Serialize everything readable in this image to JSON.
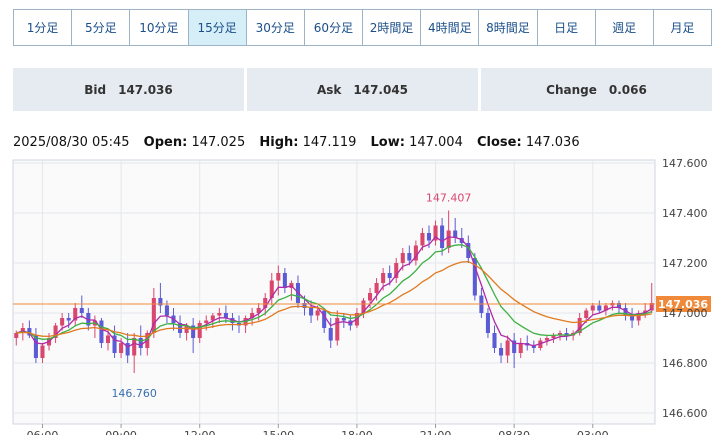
{
  "tabs": [
    {
      "label": "1分足",
      "active": false
    },
    {
      "label": "5分足",
      "active": false
    },
    {
      "label": "10分足",
      "active": false
    },
    {
      "label": "15分足",
      "active": true
    },
    {
      "label": "30分足",
      "active": false
    },
    {
      "label": "60分足",
      "active": false
    },
    {
      "label": "2時間足",
      "active": false
    },
    {
      "label": "4時間足",
      "active": false
    },
    {
      "label": "8時間足",
      "active": false
    },
    {
      "label": "日足",
      "active": false
    },
    {
      "label": "週足",
      "active": false
    },
    {
      "label": "月足",
      "active": false
    }
  ],
  "quotes": {
    "bid_label": "Bid",
    "bid_value": "147.036",
    "ask_label": "Ask",
    "ask_value": "147.045",
    "change_label": "Change",
    "change_value": "0.066"
  },
  "ohlc": {
    "datetime": "2025/08/30 05:45",
    "open_label": "Open:",
    "open": "147.025",
    "high_label": "High:",
    "high": "147.119",
    "low_label": "Low:",
    "low": "147.004",
    "close_label": "Close:",
    "close": "147.036"
  },
  "chart_data": {
    "type": "candlestick",
    "ylim": [
      146.6,
      147.6
    ],
    "y_ticks": [
      "147.600",
      "147.400",
      "147.200",
      "147.000",
      "146.800",
      "146.600"
    ],
    "x_tick_labels": [
      "06:00",
      "09:00",
      "12:00",
      "15:00",
      "18:00",
      "21:00",
      "08/30",
      "03:00"
    ],
    "x_tick_index": [
      4,
      16,
      28,
      40,
      52,
      64,
      76,
      88
    ],
    "grid": true,
    "current_price_label": "147.036",
    "current_price": 147.036,
    "annotations": [
      {
        "text": "147.407",
        "index": 66,
        "value": 147.407,
        "color": "#d9466e"
      },
      {
        "text": "146.760",
        "index": 18,
        "value": 146.76,
        "color": "#3a6fb0"
      }
    ],
    "colors": {
      "up": "#d9466e",
      "down": "#5b5bd6",
      "price_line": "#f08a3a",
      "ma_fast": "#b02aa8",
      "ma_mid": "#3cb043",
      "ma_slow": "#e07a1f"
    },
    "candles": [
      [
        146.9,
        146.93,
        146.87,
        146.92
      ],
      [
        146.92,
        146.96,
        146.89,
        146.94
      ],
      [
        146.94,
        146.97,
        146.9,
        146.91
      ],
      [
        146.91,
        146.94,
        146.8,
        146.82
      ],
      [
        146.82,
        146.88,
        146.8,
        146.87
      ],
      [
        146.87,
        146.92,
        146.85,
        146.9
      ],
      [
        146.9,
        146.96,
        146.88,
        146.95
      ],
      [
        146.95,
        147.0,
        146.93,
        146.98
      ],
      [
        146.98,
        147.0,
        146.94,
        146.97
      ],
      [
        146.97,
        147.04,
        146.95,
        147.02
      ],
      [
        147.02,
        147.07,
        146.98,
        147.0
      ],
      [
        147.0,
        147.02,
        146.93,
        146.95
      ],
      [
        146.95,
        146.99,
        146.9,
        146.97
      ],
      [
        146.97,
        146.98,
        146.86,
        146.88
      ],
      [
        146.88,
        146.93,
        146.85,
        146.91
      ],
      [
        146.91,
        146.95,
        146.82,
        146.84
      ],
      [
        146.84,
        146.9,
        146.82,
        146.88
      ],
      [
        146.88,
        146.92,
        146.8,
        146.83
      ],
      [
        146.83,
        146.92,
        146.76,
        146.9
      ],
      [
        146.9,
        146.95,
        146.83,
        146.86
      ],
      [
        146.86,
        146.93,
        146.83,
        146.92
      ],
      [
        146.92,
        147.1,
        146.9,
        147.06
      ],
      [
        147.06,
        147.12,
        147.0,
        147.03
      ],
      [
        147.03,
        147.05,
        146.96,
        146.99
      ],
      [
        146.99,
        147.02,
        146.93,
        146.96
      ],
      [
        146.96,
        146.99,
        146.9,
        146.92
      ],
      [
        146.92,
        146.96,
        146.89,
        146.95
      ],
      [
        146.95,
        146.98,
        146.84,
        146.9
      ],
      [
        146.9,
        146.97,
        146.88,
        146.96
      ],
      [
        146.96,
        146.99,
        146.93,
        146.97
      ],
      [
        146.97,
        147.0,
        146.94,
        146.99
      ],
      [
        146.99,
        147.02,
        146.96,
        147.0
      ],
      [
        147.0,
        147.03,
        146.96,
        146.98
      ],
      [
        146.98,
        147.0,
        146.93,
        146.96
      ],
      [
        146.96,
        146.99,
        146.92,
        146.95
      ],
      [
        146.95,
        146.99,
        146.92,
        146.98
      ],
      [
        146.98,
        147.02,
        146.95,
        147.0
      ],
      [
        147.0,
        147.04,
        146.97,
        147.02
      ],
      [
        147.02,
        147.08,
        146.99,
        147.06
      ],
      [
        147.06,
        147.16,
        147.03,
        147.13
      ],
      [
        147.13,
        147.19,
        147.07,
        147.16
      ],
      [
        147.16,
        147.18,
        147.08,
        147.1
      ],
      [
        147.1,
        147.13,
        147.05,
        147.12
      ],
      [
        147.12,
        147.15,
        147.02,
        147.04
      ],
      [
        147.04,
        147.07,
        146.99,
        147.02
      ],
      [
        147.02,
        147.05,
        146.96,
        146.99
      ],
      [
        146.99,
        147.03,
        146.97,
        147.01
      ],
      [
        147.01,
        147.02,
        146.92,
        146.94
      ],
      [
        146.94,
        146.98,
        146.86,
        146.89
      ],
      [
        146.89,
        147.01,
        146.87,
        146.98
      ],
      [
        146.98,
        147.0,
        146.94,
        146.97
      ],
      [
        146.97,
        146.99,
        146.93,
        146.95
      ],
      [
        146.95,
        147.02,
        146.94,
        147.0
      ],
      [
        147.0,
        147.06,
        146.98,
        147.05
      ],
      [
        147.05,
        147.1,
        147.02,
        147.08
      ],
      [
        147.08,
        147.14,
        147.05,
        147.12
      ],
      [
        147.12,
        147.18,
        147.09,
        147.16
      ],
      [
        147.16,
        147.19,
        147.11,
        147.14
      ],
      [
        147.14,
        147.22,
        147.12,
        147.2
      ],
      [
        147.2,
        147.26,
        147.17,
        147.24
      ],
      [
        147.24,
        147.27,
        147.19,
        147.21
      ],
      [
        147.21,
        147.29,
        147.19,
        147.27
      ],
      [
        147.27,
        147.34,
        147.25,
        147.32
      ],
      [
        147.32,
        147.35,
        147.26,
        147.29
      ],
      [
        147.29,
        147.37,
        147.27,
        147.35
      ],
      [
        147.35,
        147.38,
        147.23,
        147.26
      ],
      [
        147.26,
        147.41,
        147.24,
        147.33
      ],
      [
        147.33,
        147.38,
        147.28,
        147.3
      ],
      [
        147.3,
        147.34,
        147.26,
        147.28
      ],
      [
        147.28,
        147.31,
        147.2,
        147.22
      ],
      [
        147.22,
        147.24,
        147.05,
        147.07
      ],
      [
        147.07,
        147.1,
        146.98,
        147.0
      ],
      [
        147.0,
        147.02,
        146.9,
        146.92
      ],
      [
        146.92,
        146.95,
        146.84,
        146.86
      ],
      [
        146.86,
        146.88,
        146.8,
        146.83
      ],
      [
        146.83,
        146.91,
        146.8,
        146.89
      ],
      [
        146.89,
        146.92,
        146.78,
        146.84
      ],
      [
        146.84,
        146.9,
        146.82,
        146.88
      ],
      [
        146.88,
        146.91,
        146.85,
        146.87
      ],
      [
        146.87,
        146.89,
        146.84,
        146.86
      ],
      [
        146.86,
        146.9,
        146.85,
        146.89
      ],
      [
        146.89,
        146.91,
        146.87,
        146.9
      ],
      [
        146.9,
        146.92,
        146.88,
        146.91
      ],
      [
        146.91,
        146.93,
        146.89,
        146.92
      ],
      [
        146.92,
        146.94,
        146.89,
        146.91
      ],
      [
        146.91,
        146.93,
        146.89,
        146.92
      ],
      [
        146.92,
        147.0,
        146.91,
        146.98
      ],
      [
        146.98,
        147.02,
        146.96,
        147.01
      ],
      [
        147.01,
        147.04,
        146.99,
        147.03
      ],
      [
        147.03,
        147.05,
        147.0,
        147.01
      ],
      [
        147.01,
        147.04,
        146.99,
        147.03
      ],
      [
        147.03,
        147.05,
        147.01,
        147.04
      ],
      [
        147.04,
        147.05,
        147.0,
        147.02
      ],
      [
        147.02,
        147.04,
        146.97,
        146.99
      ],
      [
        146.99,
        147.02,
        146.94,
        146.97
      ],
      [
        146.97,
        147.01,
        146.95,
        147.0
      ],
      [
        147.0,
        147.04,
        146.98,
        147.01
      ],
      [
        147.01,
        147.12,
        147.0,
        147.04
      ]
    ]
  }
}
